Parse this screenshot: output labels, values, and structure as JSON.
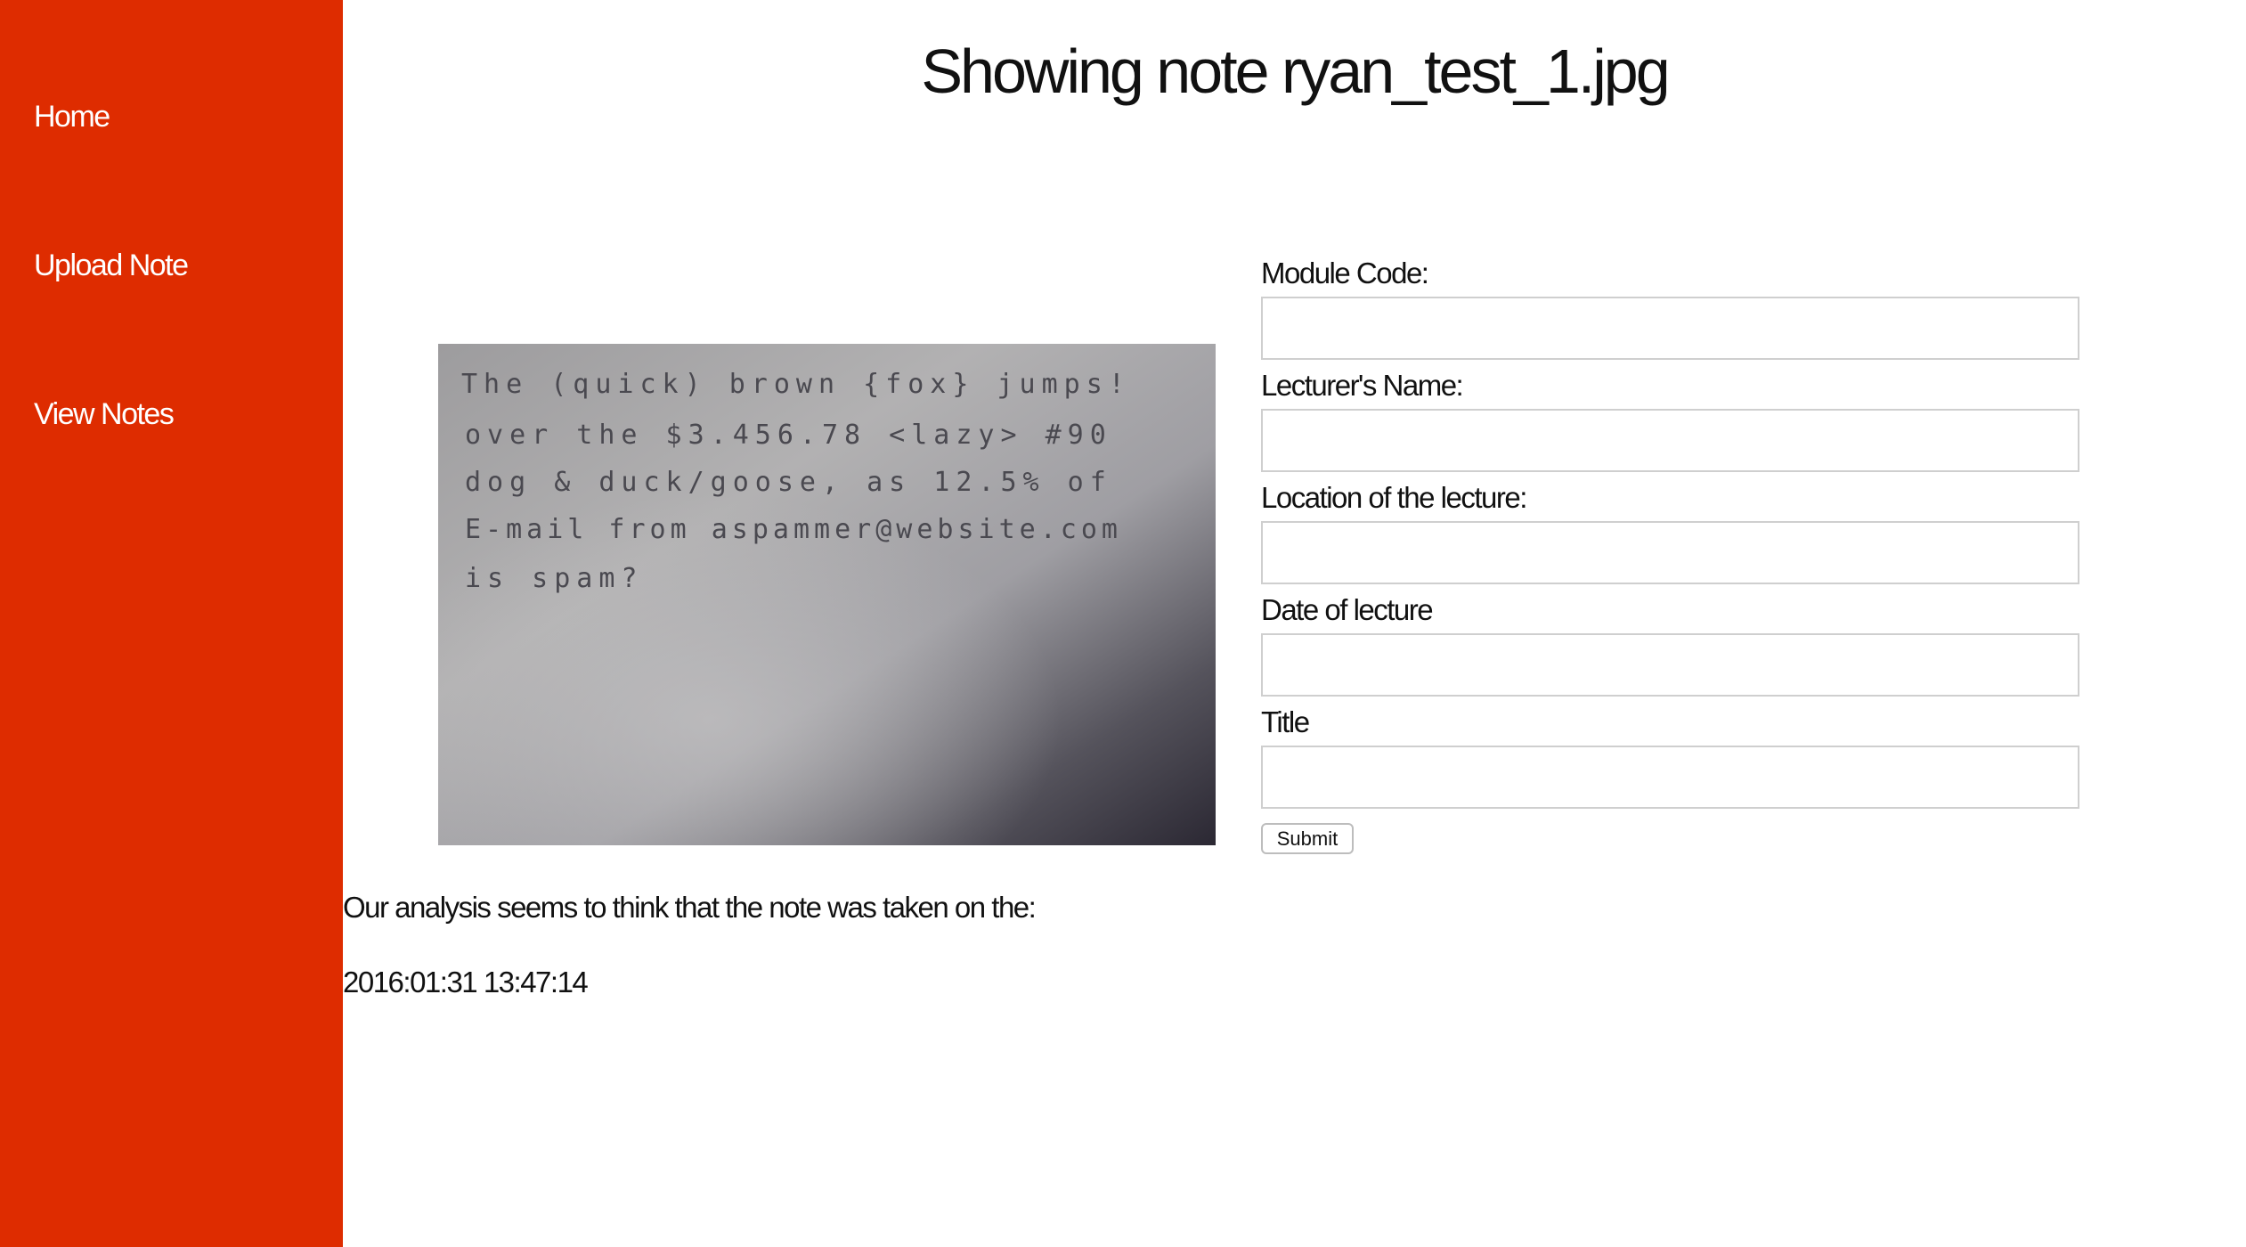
{
  "sidebar": {
    "items": [
      {
        "label": "Home"
      },
      {
        "label": "Upload Note"
      },
      {
        "label": "View Notes"
      }
    ]
  },
  "page": {
    "title": "Showing note ryan_test_1.jpg"
  },
  "note_image": {
    "lines": [
      "The (quick) brown {fox} jumps!",
      "over the $3.456.78 <lazy> #90",
      "dog & duck/goose, as 12.5% of",
      "E-mail from aspammer@website.com",
      "is spam?"
    ]
  },
  "form": {
    "module_code": {
      "label": "Module Code:",
      "value": ""
    },
    "lecturer_name": {
      "label": "Lecturer's Name:",
      "value": ""
    },
    "location": {
      "label": "Location of the lecture:",
      "value": ""
    },
    "date": {
      "label": "Date of lecture",
      "value": ""
    },
    "title": {
      "label": "Title",
      "value": ""
    },
    "submit_label": "Submit"
  },
  "analysis": {
    "text": "Our analysis seems to think that the note was taken on the:",
    "date": "2016:01:31 13:47:14"
  },
  "colors": {
    "sidebar_bg": "#de2c00",
    "sidebar_text": "#ffffff"
  }
}
